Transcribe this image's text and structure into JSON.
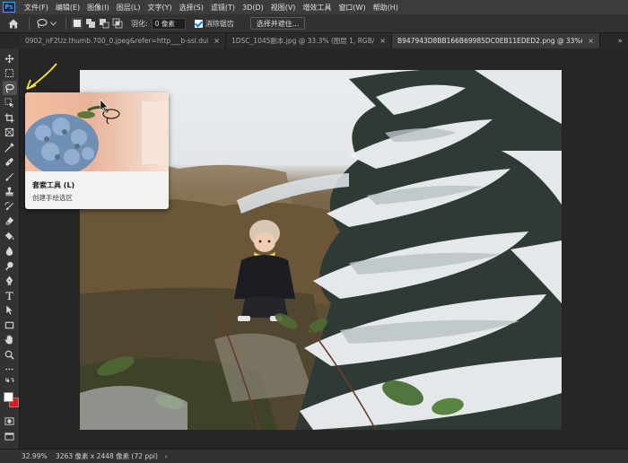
{
  "menubar": {
    "app_logo": "Ps",
    "items": [
      "文件(F)",
      "编辑(E)",
      "图像(I)",
      "图层(L)",
      "文字(Y)",
      "选择(S)",
      "滤镜(T)",
      "3D(D)",
      "视图(V)",
      "增效工具",
      "窗口(W)",
      "帮助(H)"
    ]
  },
  "options": {
    "feather_label": "羽化:",
    "feather_value": "0 像素",
    "antialias_label": "消除锯齿",
    "antialias_checked": true,
    "select_subject_button": "选择并遮住..."
  },
  "tabs": [
    {
      "label": "0902_nF2Uz.thumb.700_0.jpeg&refer=http___b-ssl.duitang-预期的.jpg",
      "active": false
    },
    {
      "label": "1DSC_1045副本.jpg @ 33.3% (图层 1, RGB/8...",
      "active": false
    },
    {
      "label": "B947943D8BB166B69985DC0EB11EDED2.png @ 33%(RGB/8) *",
      "active": true
    }
  ],
  "tab_more_icon": "double-chevron-right-icon",
  "toolbar": {
    "tools": [
      "move-icon",
      "marquee-icon",
      "lasso-icon",
      "object-select-icon",
      "crop-icon",
      "frame-icon",
      "eyedropper-icon",
      "healing-brush-icon",
      "brush-icon",
      "clone-stamp-icon",
      "history-brush-icon",
      "eraser-icon",
      "paint-bucket-icon",
      "blur-icon",
      "dodge-icon",
      "pen-icon",
      "type-icon",
      "path-select-icon",
      "rectangle-icon",
      "hand-icon",
      "zoom-icon",
      "more-tools-icon"
    ],
    "active_tool": "lasso-icon",
    "foreground_color": "#ffffff",
    "background_color": "#e8121a"
  },
  "tooltip": {
    "title": "套索工具 (L)",
    "description": "创建手绘选区"
  },
  "statusbar": {
    "zoom": "32.99%",
    "doc_info": "3263 像素 x 2448 像素 (72 ppi)",
    "arrow": "›"
  }
}
